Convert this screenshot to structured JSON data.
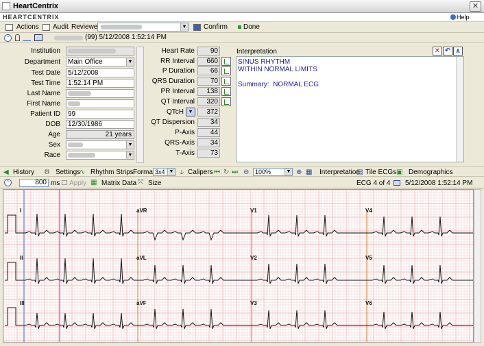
{
  "window": {
    "title": "HeartCentrix",
    "close_glyph": "✕"
  },
  "brand": {
    "logo_text": "HEARTCENTRIX",
    "help_label": "Help"
  },
  "toolbar": {
    "actions_label": "Actions",
    "audit_label": "Audit",
    "reviewer_label": "Reviewer",
    "confirm_label": "Confirm",
    "done_label": "Done"
  },
  "patient_line": {
    "info": "(99) 5/12/2008 1:52:14 PM"
  },
  "demographics": {
    "labels": {
      "institution": "Institution",
      "department": "Department",
      "test_date": "Test Date",
      "test_time": "Test Time",
      "last_name": "Last Name",
      "first_name": "First Name",
      "patient_id": "Patient ID",
      "dob": "DOB",
      "age": "Age",
      "sex": "Sex",
      "race": "Race"
    },
    "values": {
      "department": "Main Office",
      "test_date": "5/12/2008",
      "test_time": "1:52:14 PM",
      "patient_id": "99",
      "dob": "12/30/1986",
      "age": "21 years"
    }
  },
  "measurements": [
    {
      "label": "Heart Rate",
      "value": "90",
      "wave": false
    },
    {
      "label": "RR Interval",
      "value": "660",
      "wave": true
    },
    {
      "label": "P Duration",
      "value": "66",
      "wave": true
    },
    {
      "label": "QRS Duration",
      "value": "70",
      "wave": true
    },
    {
      "label": "PR Interval",
      "value": "138",
      "wave": true
    },
    {
      "label": "QT Interval",
      "value": "320",
      "wave": true
    },
    {
      "label": "QTcH",
      "value": "372",
      "wave": false
    },
    {
      "label": "QT Dispersion",
      "value": "34",
      "wave": false
    },
    {
      "label": "P-Axis",
      "value": "44",
      "wave": false
    },
    {
      "label": "QRS-Axis",
      "value": "34",
      "wave": false
    },
    {
      "label": "T-Axis",
      "value": "73",
      "wave": false
    }
  ],
  "interpretation": {
    "title": "Interpretation",
    "text": "SINUS RHYTHM\nWITHIN NORMAL LIMITS\n\nSummary:  NORMAL ECG"
  },
  "midbar": {
    "history": "History",
    "settings": "Settings",
    "rhythm_strips": "Rhythm Strips",
    "format_label": "Format",
    "format_value": "3x4",
    "calipers": "Calipers",
    "zoom_value": "100%",
    "interpretation": "Interpretation",
    "tile_ecgs": "Tile ECGs",
    "demographics": "Demographics"
  },
  "stripbar": {
    "ms_value": "800",
    "ms_unit": "ms",
    "apply": "Apply",
    "matrix_data": "Matrix Data",
    "size": "Size",
    "ecg_count": "ECG 4 of 4",
    "timestamp": "5/12/2008 1:52:14 PM"
  },
  "ecg": {
    "rows": [
      [
        "I",
        "aVR",
        "V1",
        "V4"
      ],
      [
        "II",
        "aVL",
        "V2",
        "V5"
      ],
      [
        "III",
        "aVF",
        "V3",
        "V6"
      ]
    ],
    "grid_color": "#f2b8b8",
    "major_grid_color": "#e58a8a"
  }
}
